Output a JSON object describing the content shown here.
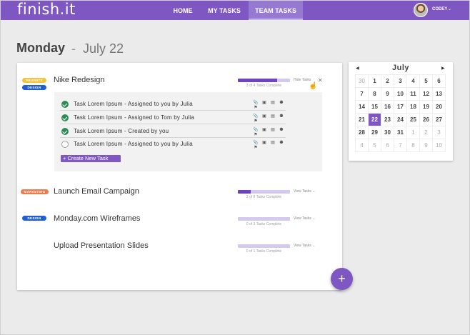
{
  "app": {
    "logo": "finish.it"
  },
  "nav": {
    "items": [
      {
        "label": "HOME"
      },
      {
        "label": "MY TASKS"
      },
      {
        "label": "TEAM TASKS",
        "active": true
      }
    ],
    "user": {
      "name": "CODEY",
      "caret": "⌄"
    }
  },
  "heading": {
    "day": "Monday",
    "separator": "-",
    "date": "July 22"
  },
  "projects": [
    {
      "badges": [
        "PRIORITY",
        "DESIGN"
      ],
      "title": "Nike Redesign",
      "progress": 0.75,
      "progress_text": "3 of 4 Tasks Complete",
      "toggle": "Hide Tasks",
      "close": "✕",
      "expanded": true,
      "tasks": [
        {
          "text": "Task Lorem Ipsum - Assigned to you by Julia",
          "done": true
        },
        {
          "text": "Task Lorem Ipsum - Assigned to Tom by Julia",
          "done": true
        },
        {
          "text": "Task Lorem Ipsum - Created by you",
          "done": true
        },
        {
          "text": "Task Lorem Ipsum - Assigned to you by Julia",
          "done": false
        }
      ],
      "create_label": "+ Create New Task"
    },
    {
      "badges": [
        "MARKETING"
      ],
      "title": "Launch Email Campaign",
      "progress": 0.25,
      "progress_text": "2 of 8 Tasks Complete",
      "toggle": "View Tasks ⌄"
    },
    {
      "badges": [
        "DESIGN"
      ],
      "title": "Monday.com Wireframes",
      "progress": 0,
      "progress_text": "0 of 3 Tasks Complete",
      "toggle": "View Tasks ⌄"
    },
    {
      "badges": [],
      "title": "Upload Presentation Slides",
      "progress": 0,
      "progress_text": "0 of 1 Tasks Complete",
      "toggle": "View Tasks ⌄"
    }
  ],
  "task_icons": [
    "paperclip-icon",
    "image-icon",
    "comment-icon",
    "assign-user-icon",
    "flag-icon"
  ],
  "fab": {
    "label": "+"
  },
  "calendar": {
    "month": "July",
    "prev": "◀",
    "next": "▶",
    "weeks": [
      [
        "30",
        "1",
        "2",
        "3",
        "4",
        "5",
        "6"
      ],
      [
        "7",
        "8",
        "9",
        "10",
        "11",
        "12",
        "13"
      ],
      [
        "14",
        "15",
        "16",
        "17",
        "18",
        "19",
        "20"
      ],
      [
        "21",
        "22",
        "23",
        "24",
        "25",
        "26",
        "27"
      ],
      [
        "28",
        "29",
        "30",
        "31",
        "1",
        "2",
        "3"
      ],
      [
        "4",
        "5",
        "6",
        "7",
        "8",
        "9",
        "10"
      ]
    ],
    "today": "22"
  },
  "colors": {
    "brand": "#7e57c2",
    "priority": "#f5c242",
    "design": "#1f5fd6",
    "marketing": "#f07a4a",
    "done": "#2e8b57"
  }
}
